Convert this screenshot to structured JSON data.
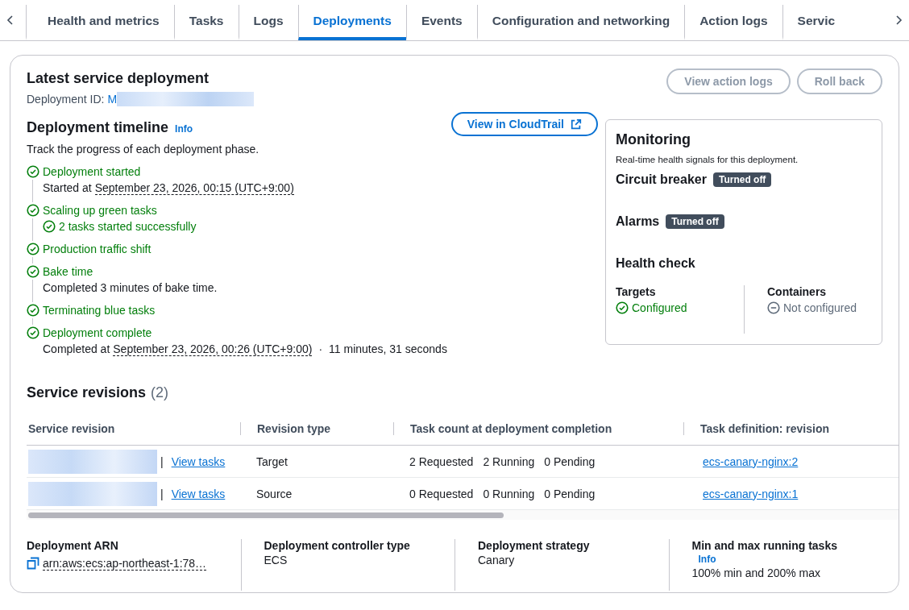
{
  "tabs": [
    {
      "label": "Health and metrics",
      "selected": false
    },
    {
      "label": "Tasks",
      "selected": false
    },
    {
      "label": "Logs",
      "selected": false
    },
    {
      "label": "Deployments",
      "selected": true
    },
    {
      "label": "Events",
      "selected": false
    },
    {
      "label": "Configuration and networking",
      "selected": false
    },
    {
      "label": "Action logs",
      "selected": false
    },
    {
      "label": "Servic",
      "selected": false
    }
  ],
  "deployment": {
    "title": "Latest service deployment",
    "id_label": "Deployment ID:",
    "id_value": "M",
    "buttons": [
      {
        "label": "View action logs",
        "disabled": true
      },
      {
        "label": "Roll back",
        "disabled": true
      }
    ]
  },
  "timeline": {
    "title": "Deployment timeline",
    "info": "Info",
    "description": "Track the progress of each deployment phase.",
    "cloudtrail_button": "View in CloudTrail",
    "steps": [
      {
        "title": "Deployment started",
        "completed": true,
        "details": [
          {
            "kind": "time",
            "prefix": "Started at",
            "value": "September 23, 2026, 00:15 (UTC+9:00)"
          }
        ]
      },
      {
        "title": "Scaling up green tasks",
        "completed": true,
        "details": [
          {
            "kind": "success",
            "text": "2 tasks started successfully"
          }
        ]
      },
      {
        "title": "Production traffic shift",
        "completed": true
      },
      {
        "title": "Bake time",
        "completed": true,
        "details": [
          {
            "kind": "text",
            "text": "Completed 3 minutes of bake time."
          }
        ]
      },
      {
        "title": "Terminating blue tasks",
        "completed": true
      },
      {
        "title": "Deployment complete",
        "completed": true,
        "details": [
          {
            "kind": "time",
            "prefix": "Completed at",
            "value": "September 23, 2026, 00:26 (UTC+9:00)",
            "separator": "·",
            "suffix": "11 minutes, 31 seconds"
          }
        ]
      }
    ]
  },
  "monitoring": {
    "title": "Monitoring",
    "description": "Real-time health signals for this deployment.",
    "signals": [
      {
        "label": "Circuit breaker",
        "badge": "Turned off"
      },
      {
        "label": "Alarms",
        "badge": "Turned off"
      }
    ],
    "health_check": {
      "title": "Health check",
      "items": [
        {
          "label": "Targets",
          "configured": true,
          "value": "Configured"
        },
        {
          "label": "Containers",
          "configured": false,
          "value": "Not configured"
        }
      ]
    }
  },
  "revisions": {
    "title": "Service revisions",
    "count": "(2)",
    "columns": [
      "Service revision",
      "Revision type",
      "Task count at deployment completion",
      "Task definition: revision"
    ],
    "rows": [
      {
        "divider": "|",
        "link": "View tasks",
        "type": "Target",
        "requested": "2 Requested",
        "running": "2 Running",
        "pending": "0 Pending",
        "task_definition": "ecs-canary-nginx:2"
      },
      {
        "divider": "|",
        "link": "View tasks",
        "type": "Source",
        "requested": "0 Requested",
        "running": "0 Running",
        "pending": "0 Pending",
        "task_definition": "ecs-canary-nginx:1"
      }
    ]
  },
  "details": [
    {
      "kind": "copy",
      "label": "Deployment ARN",
      "value": "arn:aws:ecs:ap-northeast-1:78…"
    },
    {
      "kind": "text",
      "label": "Deployment controller type",
      "value": "ECS"
    },
    {
      "kind": "text",
      "label": "Deployment strategy",
      "value": "Canary"
    },
    {
      "kind": "info",
      "label": "Min and max running tasks",
      "info": "Info",
      "value": "100% min and 200% max"
    }
  ]
}
